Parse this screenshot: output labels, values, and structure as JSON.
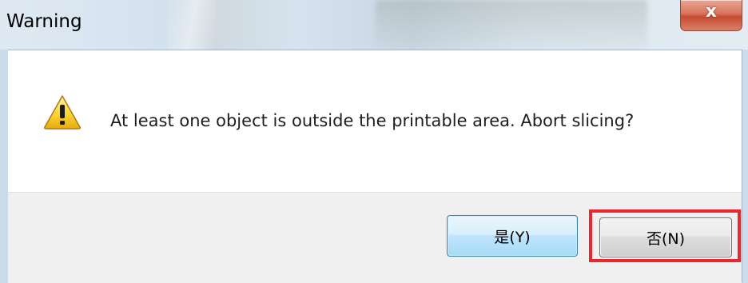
{
  "window": {
    "title": "Warning",
    "close_label": "x"
  },
  "dialog": {
    "icon": "warning-icon",
    "message": "At least one object is outside the printable area. Abort slicing?"
  },
  "buttons": {
    "yes_label": "是(Y)",
    "no_label": "否(N)"
  },
  "annotation": {
    "highlight_color": "#e8282d",
    "highlighted": "no-button"
  }
}
